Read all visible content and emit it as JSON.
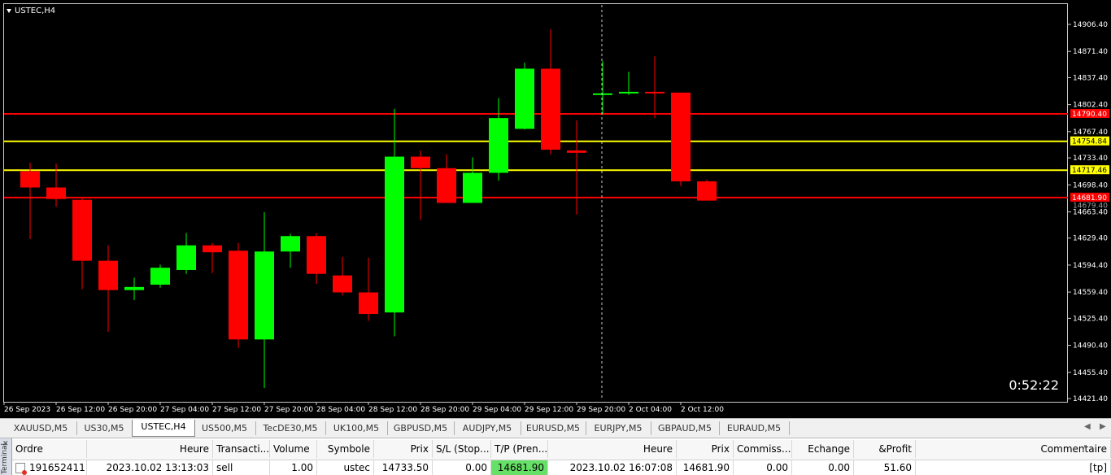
{
  "chart": {
    "title": "USTEC,H4",
    "timer": "0:52:22",
    "price_axis": [
      "14906.40",
      "14871.40",
      "14837.40",
      "14802.40",
      "14767.40",
      "14733.40",
      "14698.40",
      "14663.40",
      "14629.40",
      "14594.40",
      "14559.40",
      "14525.40",
      "14490.40",
      "14455.40",
      "14421.40"
    ],
    "time_axis": [
      "26 Sep 2023",
      "26 Sep 12:00",
      "26 Sep 20:00",
      "27 Sep 04:00",
      "27 Sep 12:00",
      "27 Sep 20:00",
      "28 Sep 04:00",
      "28 Sep 12:00",
      "28 Sep 20:00",
      "29 Sep 04:00",
      "29 Sep 12:00",
      "29 Sep 20:00",
      "2 Oct 04:00",
      "2 Oct 12:00"
    ],
    "colors": {
      "bull": "#00ff00",
      "bear": "#ff0000",
      "background": "#000000",
      "red_line": "#ff0000",
      "yellow_line": "#ffff00"
    },
    "lines": [
      {
        "price": 14790.4,
        "color": "red",
        "label": "14790.40"
      },
      {
        "price": 14754.84,
        "color": "yellow",
        "label": "14754.84"
      },
      {
        "price": 14717.46,
        "color": "yellow",
        "label": "14717.46"
      },
      {
        "price": 14681.9,
        "color": "red",
        "label": "14681.90"
      }
    ],
    "overlap_label": "14679.40"
  },
  "chart_data": {
    "type": "candlestick",
    "title": "USTEC,H4",
    "ylim": [
      14421.4,
      14906.4
    ],
    "candles": [
      {
        "o": 14716,
        "h": 14727,
        "l": 14628,
        "c": 14695
      },
      {
        "o": 14695,
        "h": 14726,
        "l": 14670,
        "c": 14680
      },
      {
        "o": 14679,
        "h": 14681,
        "l": 14563,
        "c": 14600
      },
      {
        "o": 14600,
        "h": 14620,
        "l": 14508,
        "c": 14562
      },
      {
        "o": 14562,
        "h": 14578,
        "l": 14549,
        "c": 14566
      },
      {
        "o": 14569,
        "h": 14595,
        "l": 14565,
        "c": 14591
      },
      {
        "o": 14588,
        "h": 14636,
        "l": 14583,
        "c": 14620
      },
      {
        "o": 14620,
        "h": 14623,
        "l": 14584,
        "c": 14611
      },
      {
        "o": 14613,
        "h": 14623,
        "l": 14487,
        "c": 14498
      },
      {
        "o": 14498,
        "h": 14663,
        "l": 14435,
        "c": 14612
      },
      {
        "o": 14612,
        "h": 14635,
        "l": 14591,
        "c": 14632
      },
      {
        "o": 14632,
        "h": 14636,
        "l": 14570,
        "c": 14583
      },
      {
        "o": 14581,
        "h": 14605,
        "l": 14555,
        "c": 14559
      },
      {
        "o": 14559,
        "h": 14604,
        "l": 14522,
        "c": 14531
      },
      {
        "o": 14533,
        "h": 14797,
        "l": 14502,
        "c": 14735
      },
      {
        "o": 14735,
        "h": 14743,
        "l": 14653,
        "c": 14720
      },
      {
        "o": 14720,
        "h": 14738,
        "l": 14675,
        "c": 14675
      },
      {
        "o": 14675,
        "h": 14734,
        "l": 14675,
        "c": 14714
      },
      {
        "o": 14714,
        "h": 14811,
        "l": 14704,
        "c": 14785
      },
      {
        "o": 14771,
        "h": 14857,
        "l": 14770,
        "c": 14849
      },
      {
        "o": 14849,
        "h": 14900,
        "l": 14738,
        "c": 14744
      },
      {
        "o": 14743,
        "h": 14782,
        "l": 14660,
        "c": 14740
      },
      {
        "o": 14815,
        "h": 14859,
        "l": 14790,
        "c": 14817
      },
      {
        "o": 14817,
        "h": 14845,
        "l": 14815,
        "c": 14819
      },
      {
        "o": 14819,
        "h": 14865,
        "l": 14785,
        "c": 14817
      },
      {
        "o": 14818,
        "h": 14818,
        "l": 14697,
        "c": 14703
      },
      {
        "o": 14703,
        "h": 14705,
        "l": 14678,
        "c": 14678
      }
    ]
  },
  "tabs": [
    {
      "label": "XAUUSD,M5",
      "active": false
    },
    {
      "label": "US30,M5",
      "active": false
    },
    {
      "label": "USTEC,H4",
      "active": true
    },
    {
      "label": "US500,M5",
      "active": false
    },
    {
      "label": "TecDE30,M5",
      "active": false
    },
    {
      "label": "UK100,M5",
      "active": false
    },
    {
      "label": "GBPUSD,M5",
      "active": false
    },
    {
      "label": "AUDJPY,M5",
      "active": false
    },
    {
      "label": "EURUSD,M5",
      "active": false
    },
    {
      "label": "EURJPY,M5",
      "active": false
    },
    {
      "label": "GBPAUD,M5",
      "active": false
    },
    {
      "label": "EURAUD,M5",
      "active": false
    }
  ],
  "trade_panel": {
    "side_label": "Terminal",
    "columns": [
      "Ordre",
      "Heure",
      "Transacti...",
      "Volume",
      "Symbole",
      "Prix",
      "S/L (Stop...",
      "T/P (Pren...",
      "Heure",
      "Prix",
      "Commiss...",
      "Echange",
      "&Profit",
      "Commentaire"
    ],
    "row": [
      "191652411",
      "2023.10.02 13:13:03",
      "sell",
      "1.00",
      "ustec",
      "14733.50",
      "0.00",
      "14681.90",
      "2023.10.02 16:07:08",
      "14681.90",
      "0.00",
      "0.00",
      "51.60",
      "[tp]"
    ]
  }
}
